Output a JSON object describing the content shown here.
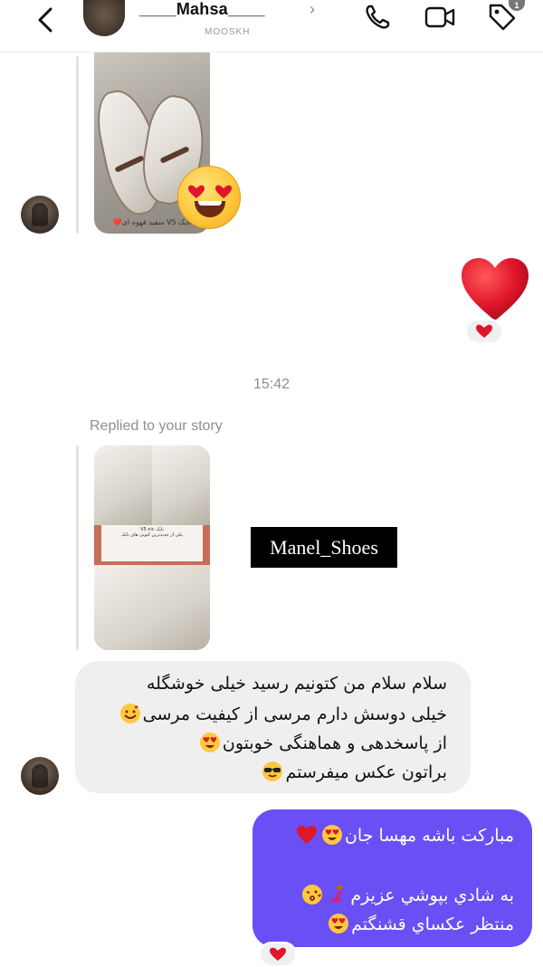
{
  "header": {
    "contact_name": "____Mahsa____",
    "contact_subtitle": "MOOSKH",
    "badge_count": "1",
    "icons": [
      "back-arrow-icon",
      "chevron-right-icon",
      "phone-icon",
      "video-icon",
      "tag-icon"
    ]
  },
  "thread": {
    "shared_post": {
      "caption": "نایک V5 سفید قهوه ای❤️"
    },
    "timestamp": "15:42",
    "replied_label": "Replied to your story",
    "story": {
      "title": "نایک V5 nic",
      "text": "یکی از جدیدترین کتونی های نایک",
      "brand_top": "Manel_Shoes",
      "brand_bottom": "Manel_Shoes"
    },
    "story_tag": "Manel_Shoes",
    "incoming_message": {
      "line1": "سلام سلام من کتونیم رسید خیلی خوشگله",
      "line2": "خیلی دوسش دارم مرسی از کیفیت مرسی",
      "line3": "از پاسخدهی و هماهنگی خوبتون",
      "line4": "براتون عکس میفرستم"
    },
    "outgoing_message": {
      "line1": "مبارکت باشه مهسا جان",
      "line2": "به شادي بپوشي عزيزم",
      "line3": "منتظر عکساي قشنگتم"
    }
  },
  "colors": {
    "outgoing_bubble": "#6a4ff5",
    "incoming_bubble": "#efefef",
    "heart": "#e0162b"
  }
}
